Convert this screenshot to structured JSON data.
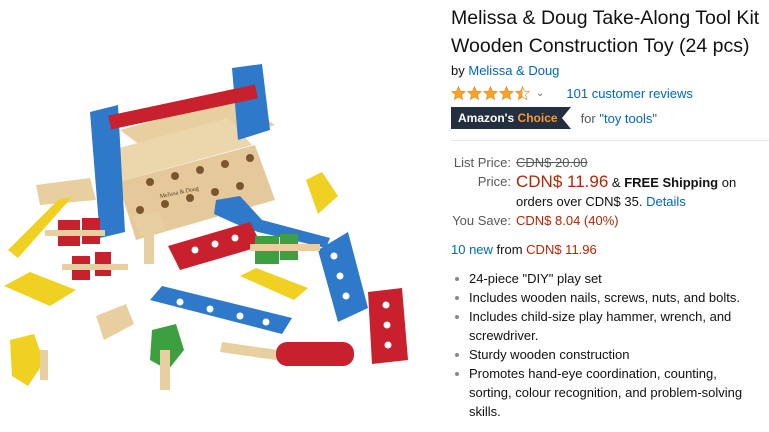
{
  "product": {
    "title_line1": "Melissa & Doug Take-Along Tool Kit",
    "title_line2": "Wooden Construction Toy (24 pcs)",
    "by_prefix": "by",
    "brand": "Melissa & Doug",
    "rating": 4.5,
    "reviews_label": "101 customer reviews"
  },
  "badge": {
    "amazons": "Amazon's",
    "choice": "Choice",
    "for_prefix": "for",
    "query": "\"toy tools\""
  },
  "pricing": {
    "list_label": "List Price:",
    "list_value": "CDN$ 20.00",
    "price_label": "Price:",
    "price_value": "CDN$ 11.96",
    "amp": "&",
    "free_shipping": "FREE Shipping",
    "on": "on",
    "ship_line2": "orders over CDN$ 35.",
    "details": "Details",
    "save_label": "You Save:",
    "save_value": "CDN$ 8.04 (40%)"
  },
  "offers": {
    "new_count": "10 new",
    "from": "from",
    "from_price": "CDN$ 11.96"
  },
  "bullets": [
    "24-piece \"DIY\" play set",
    "Includes wooden nails, screws, nuts, and bolts.",
    "Includes child-size play hammer, wrench, and screwdriver.",
    "Sturdy wooden construction",
    "Promotes hand-eye coordination, counting, sorting, colour recognition, and problem-solving skills."
  ],
  "colors": {
    "link": "#0066c0",
    "price": "#b12704",
    "star": "#ffa41c",
    "badge_bg": "#232f3e",
    "badge_accent": "#f69931"
  },
  "icons": {
    "rating_stars": "star-icon",
    "rating_dropdown": "chevron-down-icon"
  }
}
